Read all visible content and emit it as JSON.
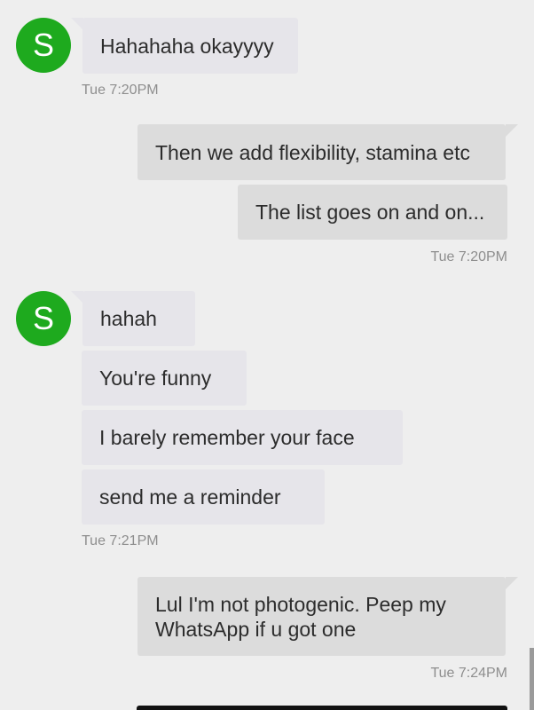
{
  "contact": {
    "avatar_letter": "S",
    "avatar_color": "#1eaa1e"
  },
  "messages": {
    "g1": {
      "m1": "Hahahaha okayyyy",
      "time": "Tue 7:20PM"
    },
    "g2": {
      "m1": "Then we add flexibility, stamina etc",
      "m2": "The list goes on and on...",
      "time": "Tue 7:20PM"
    },
    "g3": {
      "m1": "hahah",
      "m2": "You're funny",
      "m3": "I barely remember your face",
      "m4": "send me a reminder",
      "time": "Tue 7:21PM"
    },
    "g4": {
      "m1": "Lul I'm not photogenic. Peep my WhatsApp if u got one",
      "time": "Tue 7:24PM"
    }
  },
  "colors": {
    "background": "#eeeeee",
    "incoming_bubble": "#e6e5ea",
    "outgoing_bubble": "#dcdcdc",
    "timestamp_text": "#8e8e8e"
  }
}
